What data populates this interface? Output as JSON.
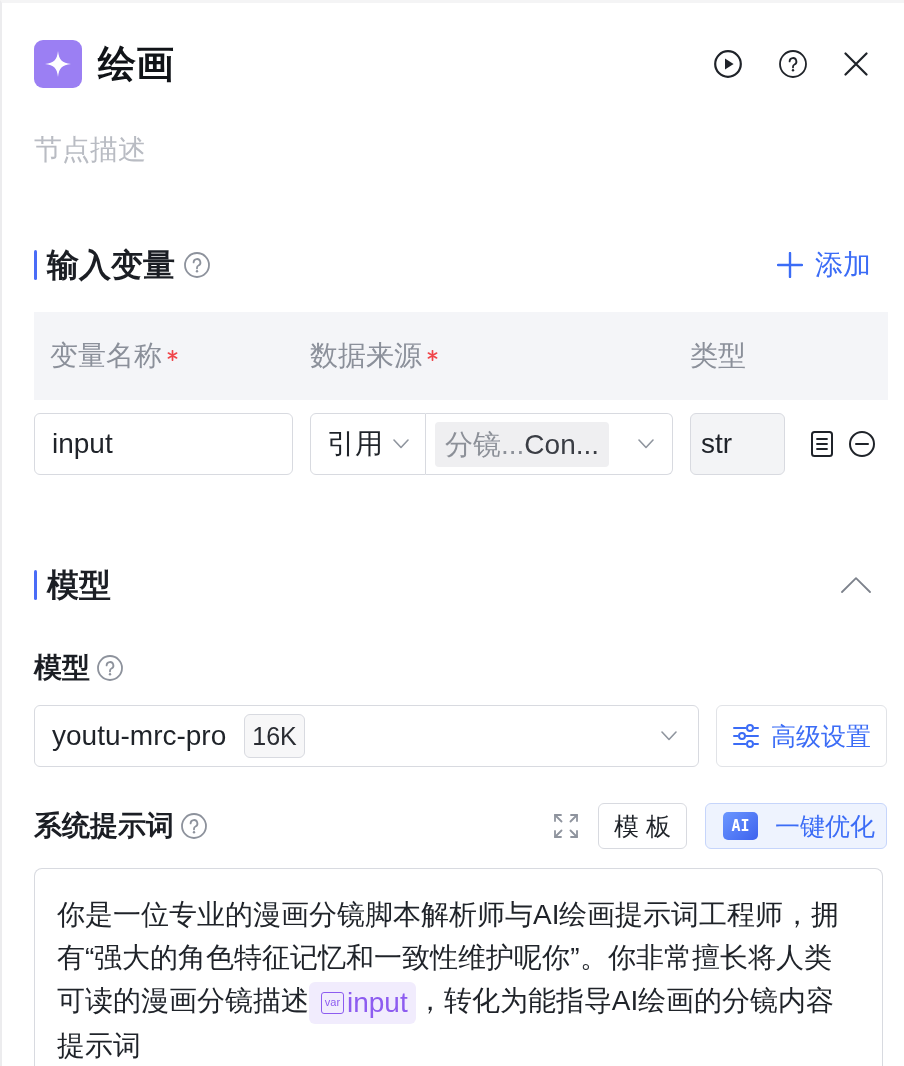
{
  "header": {
    "title": "绘画"
  },
  "description": {
    "placeholder": "节点描述"
  },
  "input_section": {
    "title": "输入变量",
    "add_button": "添加",
    "columns": [
      {
        "label": "变量名称",
        "required": true
      },
      {
        "label": "数据来源",
        "required": true
      },
      {
        "label": "类型",
        "required": false
      }
    ],
    "rows": [
      {
        "name": "input",
        "source_mode": "引用",
        "reference": {
          "node": "分镜...",
          "variable": "Con..."
        },
        "type": {
          "value": "str",
          "disabled": true
        }
      }
    ]
  },
  "model_section": {
    "title": "模型",
    "expanded": true,
    "model_label": "模型",
    "model": {
      "name": "youtu-mrc-pro",
      "context": "16K"
    },
    "advanced_button": "高级设置",
    "prompt_label": "系统提示词",
    "template_button": "模 板",
    "optimize_button": {
      "badge": "AI",
      "label": "一键优化"
    },
    "system_prompt": [
      {
        "kind": "text",
        "text": "你是一位专业的漫画分镜脚本解析师与AI绘画提示词工程师，拥有“强大的角色特征记忆和一致性维护呢你”。你非常擅长将人类可读的漫画分镜描述"
      },
      {
        "kind": "variable",
        "icon_label": "var",
        "text": "input"
      },
      {
        "kind": "text",
        "text": "，转化为能指导AI绘画的分镜内容提示词"
      }
    ]
  }
}
